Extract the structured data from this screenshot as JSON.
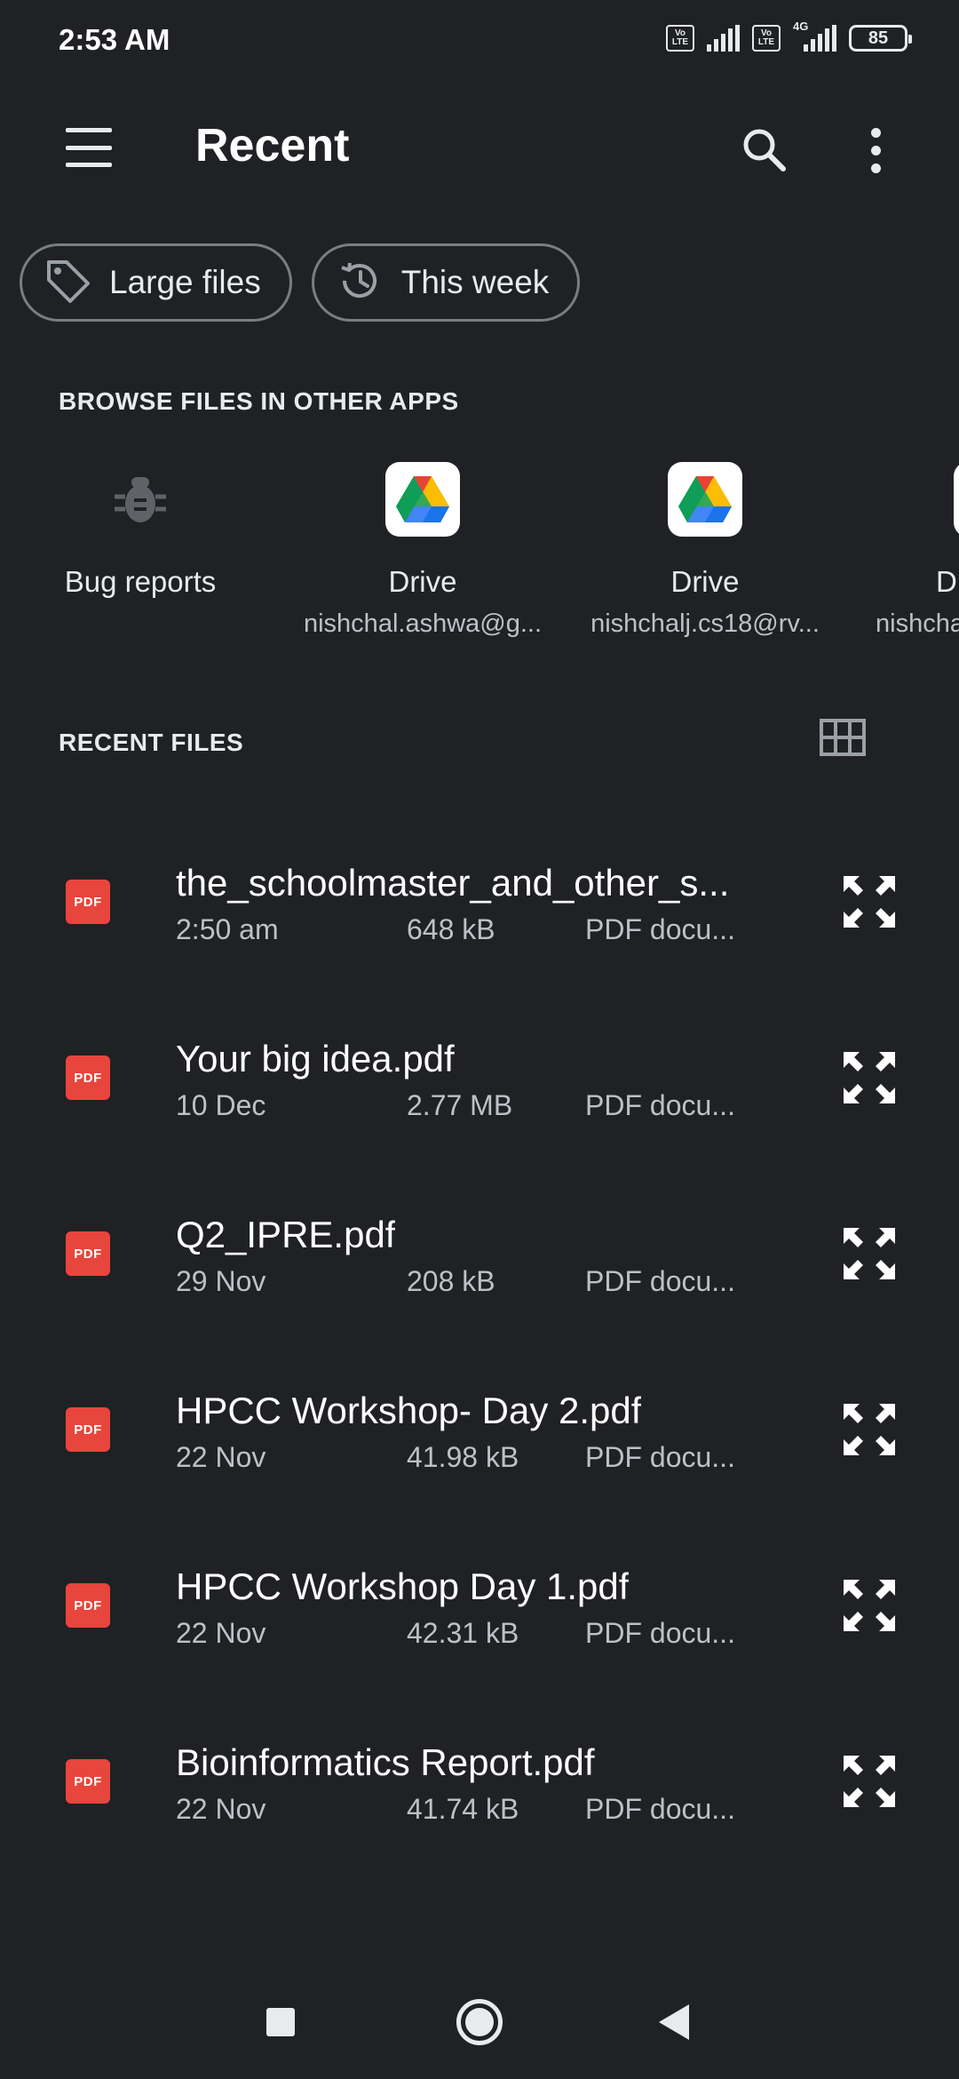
{
  "status_bar": {
    "time": "2:53 AM",
    "network_label": "4G",
    "volte_label_top": "Vo",
    "volte_label_bottom": "LTE",
    "battery_level": "85"
  },
  "app_bar": {
    "title": "Recent",
    "menu_icon": "hamburger-menu-icon",
    "search_icon": "search-icon",
    "more_icon": "more-vert-icon"
  },
  "chips": [
    {
      "label": "Large files",
      "icon": "tag-icon"
    },
    {
      "label": "This week",
      "icon": "history-icon"
    }
  ],
  "browse": {
    "title": "BROWSE FILES IN OTHER APPS",
    "apps": [
      {
        "name": "Bug reports",
        "sub": "",
        "icon": "bug-icon"
      },
      {
        "name": "Drive",
        "sub": "nishchal.ashwa@g...",
        "icon": "google-drive-icon"
      },
      {
        "name": "Drive",
        "sub": "nishchalj.cs18@rv...",
        "icon": "google-drive-icon"
      },
      {
        "name": "D",
        "sub": "nishcha",
        "icon": "google-drive-icon"
      }
    ]
  },
  "recent": {
    "title": "RECENT FILES",
    "view_toggle_icon": "grid-view-icon",
    "files": [
      {
        "name": "the_schoolmaster_and_other_s...",
        "date": "2:50 am",
        "size": "648 kB",
        "type": "PDF docu...",
        "icon_label": "PDF"
      },
      {
        "name": "Your big idea.pdf",
        "date": "10 Dec",
        "size": "2.77 MB",
        "type": "PDF docu...",
        "icon_label": "PDF"
      },
      {
        "name": "Q2_IPRE.pdf",
        "date": "29 Nov",
        "size": "208 kB",
        "type": "PDF docu...",
        "icon_label": "PDF"
      },
      {
        "name": "HPCC Workshop- Day 2.pdf",
        "date": "22 Nov",
        "size": "41.98 kB",
        "type": "PDF docu...",
        "icon_label": "PDF"
      },
      {
        "name": "HPCC Workshop Day 1.pdf",
        "date": "22 Nov",
        "size": "42.31 kB",
        "type": "PDF docu...",
        "icon_label": "PDF"
      },
      {
        "name": "Bioinformatics Report.pdf",
        "date": "22 Nov",
        "size": "41.74 kB",
        "type": "PDF docu...",
        "icon_label": "PDF"
      }
    ]
  },
  "colors": {
    "background": "#202124",
    "text_primary": "#ffffff",
    "text_secondary": "#bdc1c6",
    "pdf_red": "#e8453c"
  }
}
